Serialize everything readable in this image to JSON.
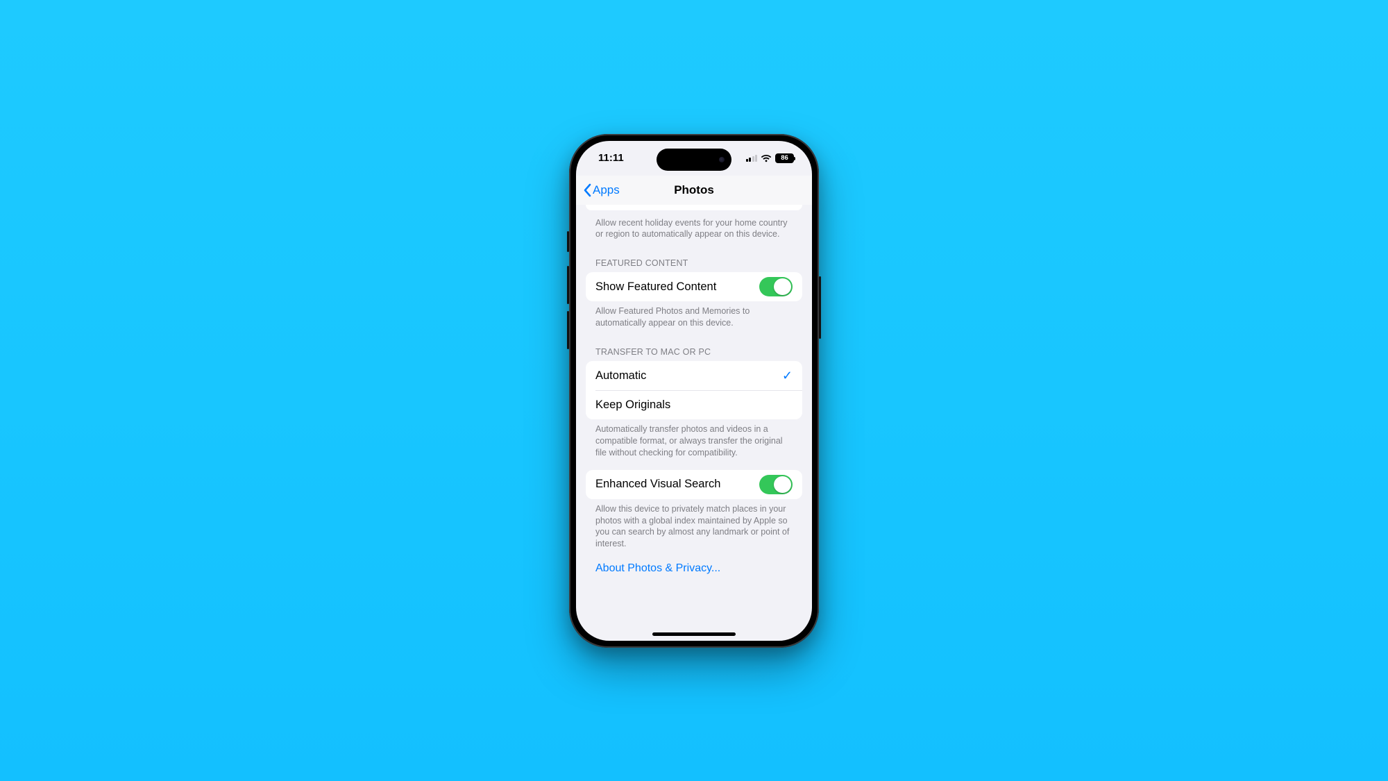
{
  "status": {
    "time": "11:11",
    "battery": "86",
    "signal_bars_active": 2
  },
  "nav": {
    "back_label": "Apps",
    "title": "Photos"
  },
  "holiday_footer": "Allow recent holiday events for your home country or region to automatically appear on this device.",
  "featured": {
    "header": "FEATURED CONTENT",
    "row_label": "Show Featured Content",
    "on": true,
    "footer": "Allow Featured Photos and Memories to automatically appear on this device."
  },
  "transfer": {
    "header": "TRANSFER TO MAC OR PC",
    "options": [
      {
        "label": "Automatic",
        "selected": true
      },
      {
        "label": "Keep Originals",
        "selected": false
      }
    ],
    "footer": "Automatically transfer photos and videos in a compatible format, or always transfer the original file without checking for compatibility."
  },
  "evs": {
    "row_label": "Enhanced Visual Search",
    "on": true,
    "footer": "Allow this device to privately match places in your photos with a global index maintained by Apple so you can search by almost any landmark or point of interest."
  },
  "privacy_link": "About Photos & Privacy..."
}
